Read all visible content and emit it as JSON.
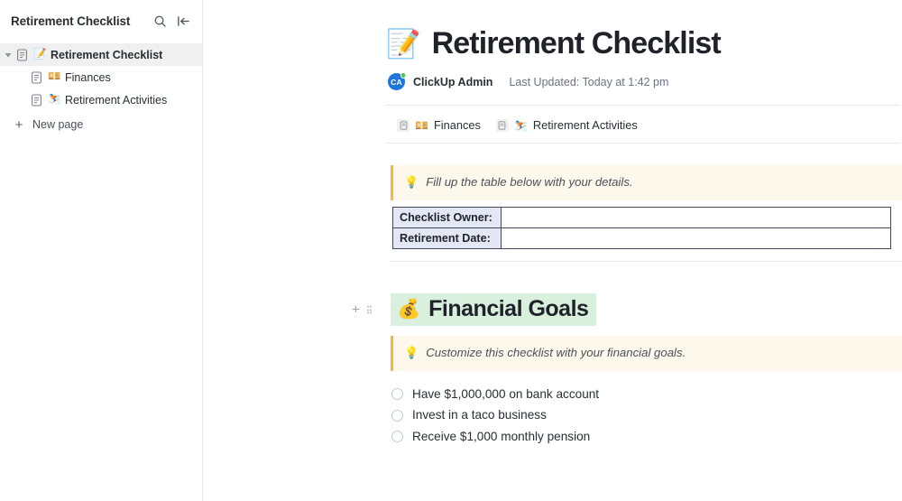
{
  "sidebar": {
    "title": "Retirement Checklist",
    "search_icon": "search-icon",
    "collapse_icon": "collapse-sidebar-icon",
    "tree": [
      {
        "emoji": "📝",
        "label": "Retirement Checklist",
        "level": 0,
        "selected": true,
        "expanded": true
      },
      {
        "emoji": "💴",
        "label": "Finances",
        "level": 1,
        "selected": false,
        "expanded": false
      },
      {
        "emoji": "⛷️",
        "label": "Retirement Activities",
        "level": 1,
        "selected": false,
        "expanded": false
      }
    ],
    "new_page_label": "New page",
    "new_page_icon": "plus-icon"
  },
  "document": {
    "title": "Retirement Checklist",
    "title_emoji": "📝",
    "author_initials": "CA",
    "author": "ClickUp Admin",
    "last_updated": "Last Updated: Today at 1:42 pm",
    "subpages": [
      {
        "emoji": "💴",
        "label": "Finances"
      },
      {
        "emoji": "⛷️",
        "label": "Retirement Activities"
      }
    ],
    "callout_1": {
      "emoji": "💡",
      "text": "Fill up the table below with your details."
    },
    "table": {
      "rows": [
        {
          "header": "Checklist Owner:",
          "value": ""
        },
        {
          "header": "Retirement Date:",
          "value": ""
        }
      ]
    },
    "section_heading": {
      "emoji": "💰",
      "text": "Financial Goals",
      "highlight_color": "#d8f0dd",
      "add_block_icon": "plus-icon",
      "drag_handle_icon": "drag-handle-icon"
    },
    "callout_2": {
      "emoji": "💡",
      "text": "Customize this checklist with your financial goals."
    },
    "checklist": [
      {
        "label": "Have $1,000,000 on bank account",
        "checked": false
      },
      {
        "label": "Invest in a taco business",
        "checked": false
      },
      {
        "label": "Receive $1,000 monthly pension",
        "checked": false
      }
    ]
  },
  "colors": {
    "callout_bg": "#fdf8ec",
    "callout_border": "#f5b93a",
    "table_header_bg": "#e4e7f5",
    "table_border": "#44475a",
    "avatar_bg": "#1d76db",
    "status_dot": "#3ecf4c"
  }
}
